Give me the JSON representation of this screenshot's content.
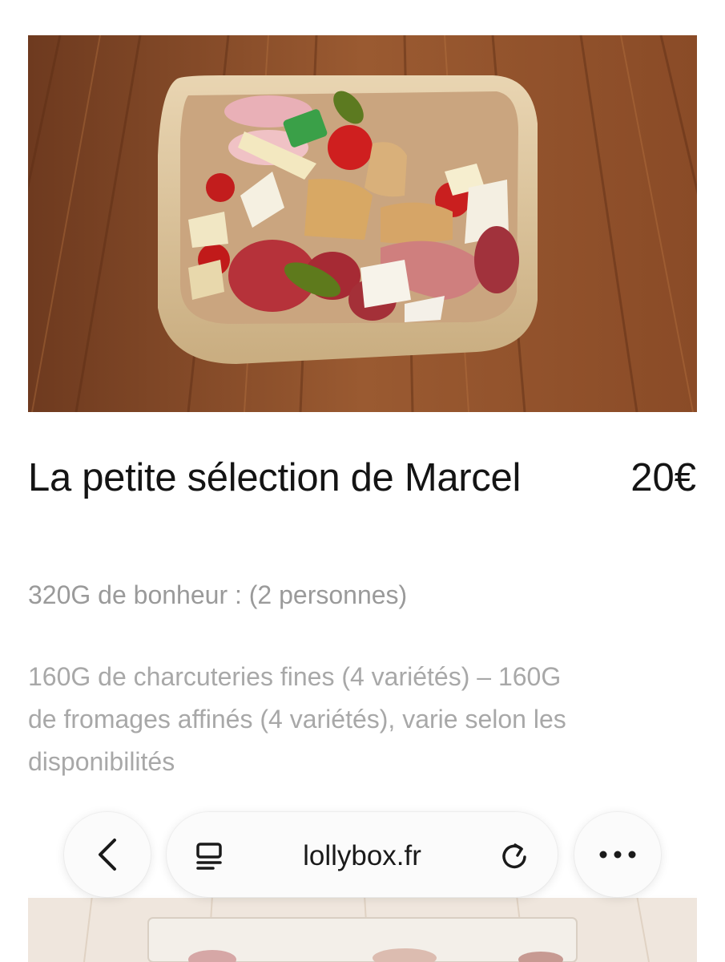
{
  "product": {
    "title": "La petite sélection de Marcel",
    "price": "20€",
    "subtitle": "320G de bonheur : (2 personnes)",
    "description": "160G de charcuteries fines (4 variétés) – 160G de fromages affinés (4 variétés),  varie selon les disponibilités"
  },
  "browser": {
    "url": "lollybox.fr",
    "icons": {
      "back": "chevron-left-icon",
      "reader": "reader-mode-icon",
      "reload": "reload-icon",
      "more": "ellipsis-icon"
    }
  },
  "colors": {
    "title": "#141414",
    "muted_text": "#9a9a9a",
    "pill_background": "#fbfbfb"
  }
}
